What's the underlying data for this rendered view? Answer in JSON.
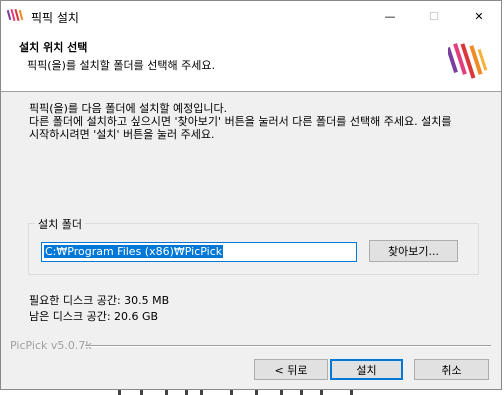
{
  "window": {
    "title": "픽픽 설치",
    "minimize_glyph": "—",
    "maximize_glyph": "☐",
    "close_glyph": "✕"
  },
  "header": {
    "title": "설치 위치 선택",
    "subtitle": "픽픽(을)를 설치할 폴더를 선택해 주세요."
  },
  "intro": [
    "픽픽(을)를 다음 폴더에 설치할 예정입니다.",
    "다른 폴더에 설치하고 싶으시면 '찾아보기' 버튼을 눌러서 다른 폴더를 선택해 주세요. 설치를",
    "시작하시려면 '설치' 버튼을 눌러 주세요."
  ],
  "destination": {
    "group_label": "설치 폴더",
    "path": "C:₩Program Files (x86)₩PicPick",
    "browse_label": "찾아보기..."
  },
  "space": {
    "required": "필요한 디스크 공간: 30.5 MB",
    "available": "남은 디스크 공간: 20.6 GB"
  },
  "version": "PicPick v5.0.7k",
  "buttons": {
    "back": "< 뒤로",
    "install": "설치",
    "cancel": "취소"
  },
  "colors": {
    "accent": "#0078d7",
    "logo_red": "#d9373a",
    "logo_orange": "#f08a24",
    "logo_purple": "#7b3fa0",
    "logo_pink": "#e23d7c"
  }
}
